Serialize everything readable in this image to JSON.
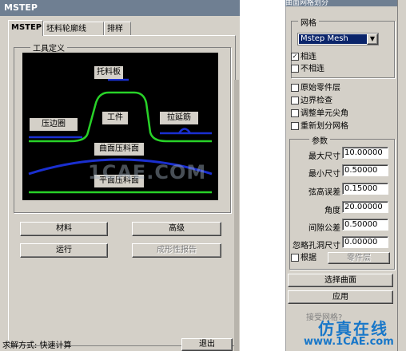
{
  "left_dialog": {
    "title": "MSTEP",
    "tabs": [
      "MSTEP",
      "坯料轮廓线",
      "排样"
    ],
    "group_label": "工具定义",
    "figure_labels": {
      "holder": "托料板",
      "part": "工件",
      "binder": "压边圈",
      "drawbead": "拉延筋",
      "curved_blankholder": "曲面压料面",
      "flat_blankholder": "平面压料面"
    },
    "buttons": {
      "material": "材料",
      "advanced": "高级",
      "run": "运行",
      "formability_report": "成形性报告"
    },
    "status": "求解方式: 快速计算",
    "exit": "退出"
  },
  "right_dialog": {
    "title": "曲面网格划分",
    "mesh_group_label": "网格",
    "mesh_select": "Mstep Mesh",
    "connect_options": [
      {
        "label": "相连",
        "checked": true
      },
      {
        "label": "不相连",
        "checked": false
      }
    ],
    "options": [
      {
        "label": "原始零件层",
        "checked": false
      },
      {
        "label": "边界检查",
        "checked": false
      },
      {
        "label": "调整单元尖角",
        "checked": false
      },
      {
        "label": "重新划分网格",
        "checked": false
      }
    ],
    "params_label": "参数",
    "params": [
      {
        "label": "最大尺寸",
        "value": "10.00000"
      },
      {
        "label": "最小尺寸",
        "value": "0.50000"
      },
      {
        "label": "弦高误差",
        "value": "0.15000"
      },
      {
        "label": "角度",
        "value": "20.00000"
      },
      {
        "label": "间隙公差",
        "value": "0.50000"
      },
      {
        "label": "忽略孔洞尺寸",
        "value": "0.00000"
      }
    ],
    "root_label": "根据",
    "part_layer_button": "零件层",
    "select_surface": "选择曲面",
    "apply": "应用",
    "accept_mesh": "接受网格?"
  },
  "watermarks": {
    "center": "1CAE.COM",
    "brand_cn": "仿真在线",
    "brand_url": "www.1CAE.com"
  },
  "colors": {
    "title_bar": "#6f7f92",
    "dialog_bg": "#d4d0c8",
    "select_bg": "#0a246a",
    "green_line": "#28d228",
    "blue_line": "#1a2fd0",
    "brand_blue": "#1877c9"
  }
}
